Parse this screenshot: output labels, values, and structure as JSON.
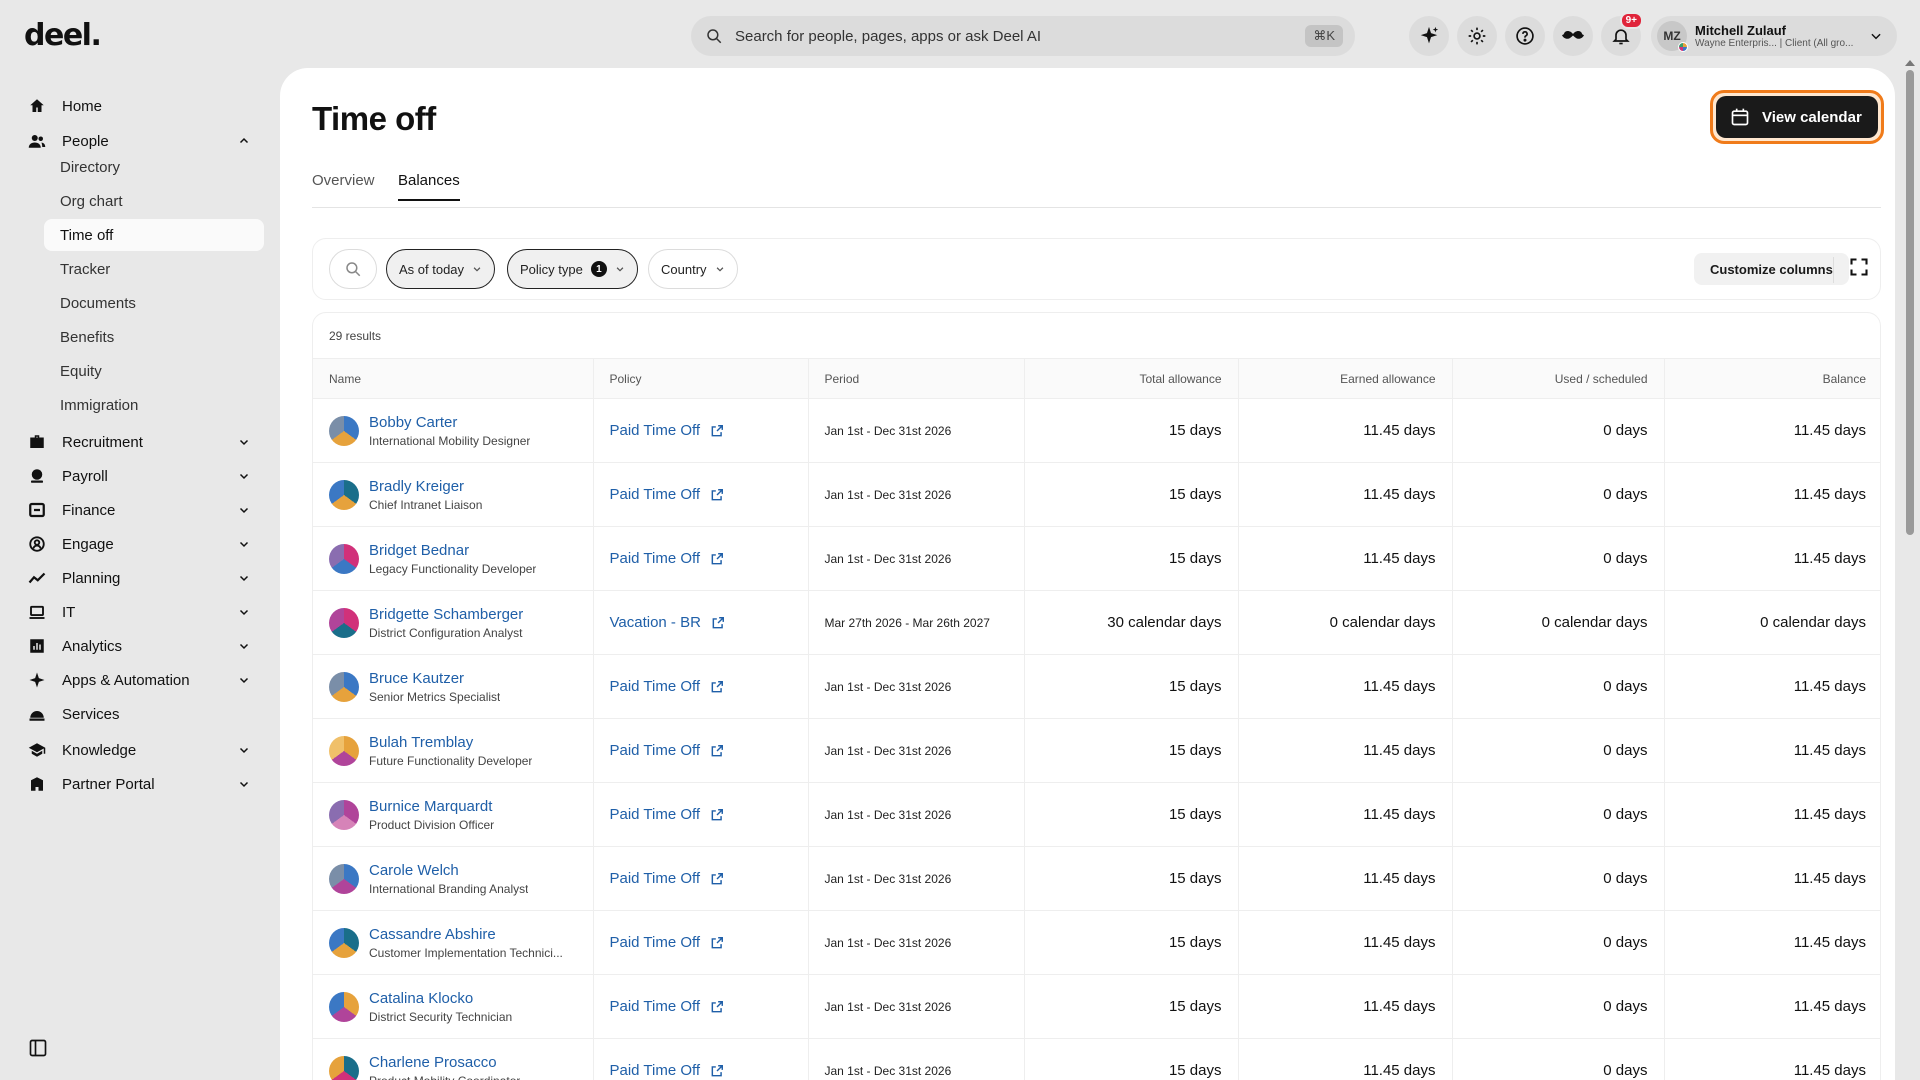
{
  "app": {
    "logo": "deel."
  },
  "search": {
    "placeholder": "Search for people, pages, apps or ask Deel AI",
    "shortcut": "⌘K"
  },
  "topbar": {
    "icons": [
      "ai-sparkle-icon",
      "settings-icon",
      "help-icon",
      "mustache-icon",
      "bell-icon"
    ],
    "notification_badge": "9+",
    "user": {
      "initials": "MZ",
      "name": "Mitchell Zulauf",
      "subtitle": "Wayne Enterpris... | Client (All gro..."
    }
  },
  "sidebar": {
    "items": [
      {
        "label": "Home",
        "icon": "home-icon"
      },
      {
        "label": "People",
        "icon": "people-icon",
        "expanded": true
      },
      {
        "label": "Recruitment",
        "icon": "briefcase-icon"
      },
      {
        "label": "Payroll",
        "icon": "payroll-icon"
      },
      {
        "label": "Finance",
        "icon": "finance-icon"
      },
      {
        "label": "Engage",
        "icon": "engage-icon"
      },
      {
        "label": "Planning",
        "icon": "planning-icon"
      },
      {
        "label": "IT",
        "icon": "laptop-icon"
      },
      {
        "label": "Analytics",
        "icon": "analytics-icon"
      },
      {
        "label": "Apps & Automation",
        "icon": "apps-icon"
      },
      {
        "label": "Services",
        "icon": "services-icon"
      },
      {
        "label": "Knowledge",
        "icon": "knowledge-icon"
      },
      {
        "label": "Partner Portal",
        "icon": "partner-icon"
      }
    ],
    "people_sub": [
      "Directory",
      "Org chart",
      "Time off",
      "Tracker",
      "Documents",
      "Benefits",
      "Equity",
      "Immigration"
    ],
    "active_sub": "Time off"
  },
  "page": {
    "title": "Time off",
    "view_calendar": "View calendar",
    "tabs": [
      "Overview",
      "Balances"
    ],
    "active_tab": "Balances"
  },
  "filters": {
    "as_of": "As of today",
    "policy_type": "Policy type",
    "policy_type_count": "1",
    "country": "Country",
    "customize": "Customize columns"
  },
  "table": {
    "results": "29 results",
    "columns": [
      "Name",
      "Policy",
      "Period",
      "Total allowance",
      "Earned allowance",
      "Used / scheduled",
      "Balance"
    ],
    "rows": [
      {
        "name": "Bobby Carter",
        "title": "International Mobility Designer",
        "policy": "Paid Time Off",
        "period": "Jan 1st - Dec 31st 2026",
        "total": "15 days",
        "earned": "11.45 days",
        "used": "0 days",
        "balance": "11.45 days"
      },
      {
        "name": "Bradly Kreiger",
        "title": "Chief Intranet Liaison",
        "policy": "Paid Time Off",
        "period": "Jan 1st - Dec 31st 2026",
        "total": "15 days",
        "earned": "11.45 days",
        "used": "0 days",
        "balance": "11.45 days"
      },
      {
        "name": "Bridget Bednar",
        "title": "Legacy Functionality Developer",
        "policy": "Paid Time Off",
        "period": "Jan 1st - Dec 31st 2026",
        "total": "15 days",
        "earned": "11.45 days",
        "used": "0 days",
        "balance": "11.45 days"
      },
      {
        "name": "Bridgette Schamberger",
        "title": "District Configuration Analyst",
        "policy": "Vacation - BR",
        "period": "Mar 27th 2026 - Mar 26th 2027",
        "total": "30 calendar days",
        "earned": "0 calendar days",
        "used": "0 calendar days",
        "balance": "0 calendar days"
      },
      {
        "name": "Bruce Kautzer",
        "title": "Senior Metrics Specialist",
        "policy": "Paid Time Off",
        "period": "Jan 1st - Dec 31st 2026",
        "total": "15 days",
        "earned": "11.45 days",
        "used": "0 days",
        "balance": "11.45 days"
      },
      {
        "name": "Bulah Tremblay",
        "title": "Future Functionality Developer",
        "policy": "Paid Time Off",
        "period": "Jan 1st - Dec 31st 2026",
        "total": "15 days",
        "earned": "11.45 days",
        "used": "0 days",
        "balance": "11.45 days"
      },
      {
        "name": "Burnice Marquardt",
        "title": "Product Division Officer",
        "policy": "Paid Time Off",
        "period": "Jan 1st - Dec 31st 2026",
        "total": "15 days",
        "earned": "11.45 days",
        "used": "0 days",
        "balance": "11.45 days"
      },
      {
        "name": "Carole Welch",
        "title": "International Branding Analyst",
        "policy": "Paid Time Off",
        "period": "Jan 1st - Dec 31st 2026",
        "total": "15 days",
        "earned": "11.45 days",
        "used": "0 days",
        "balance": "11.45 days"
      },
      {
        "name": "Cassandre Abshire",
        "title": "Customer Implementation Technici...",
        "policy": "Paid Time Off",
        "period": "Jan 1st - Dec 31st 2026",
        "total": "15 days",
        "earned": "11.45 days",
        "used": "0 days",
        "balance": "11.45 days"
      },
      {
        "name": "Catalina Klocko",
        "title": "District Security Technician",
        "policy": "Paid Time Off",
        "period": "Jan 1st - Dec 31st 2026",
        "total": "15 days",
        "earned": "11.45 days",
        "used": "0 days",
        "balance": "11.45 days"
      },
      {
        "name": "Charlene Prosacco",
        "title": "Product Mobility Coordinator",
        "policy": "Paid Time Off",
        "period": "Jan 1st - Dec 31st 2026",
        "total": "15 days",
        "earned": "11.45 days",
        "used": "0 days",
        "balance": "11.45 days"
      }
    ]
  },
  "colors": {
    "link": "#1f5fa8",
    "focus_ring": "#f07b1a",
    "badge": "#e0243a"
  }
}
